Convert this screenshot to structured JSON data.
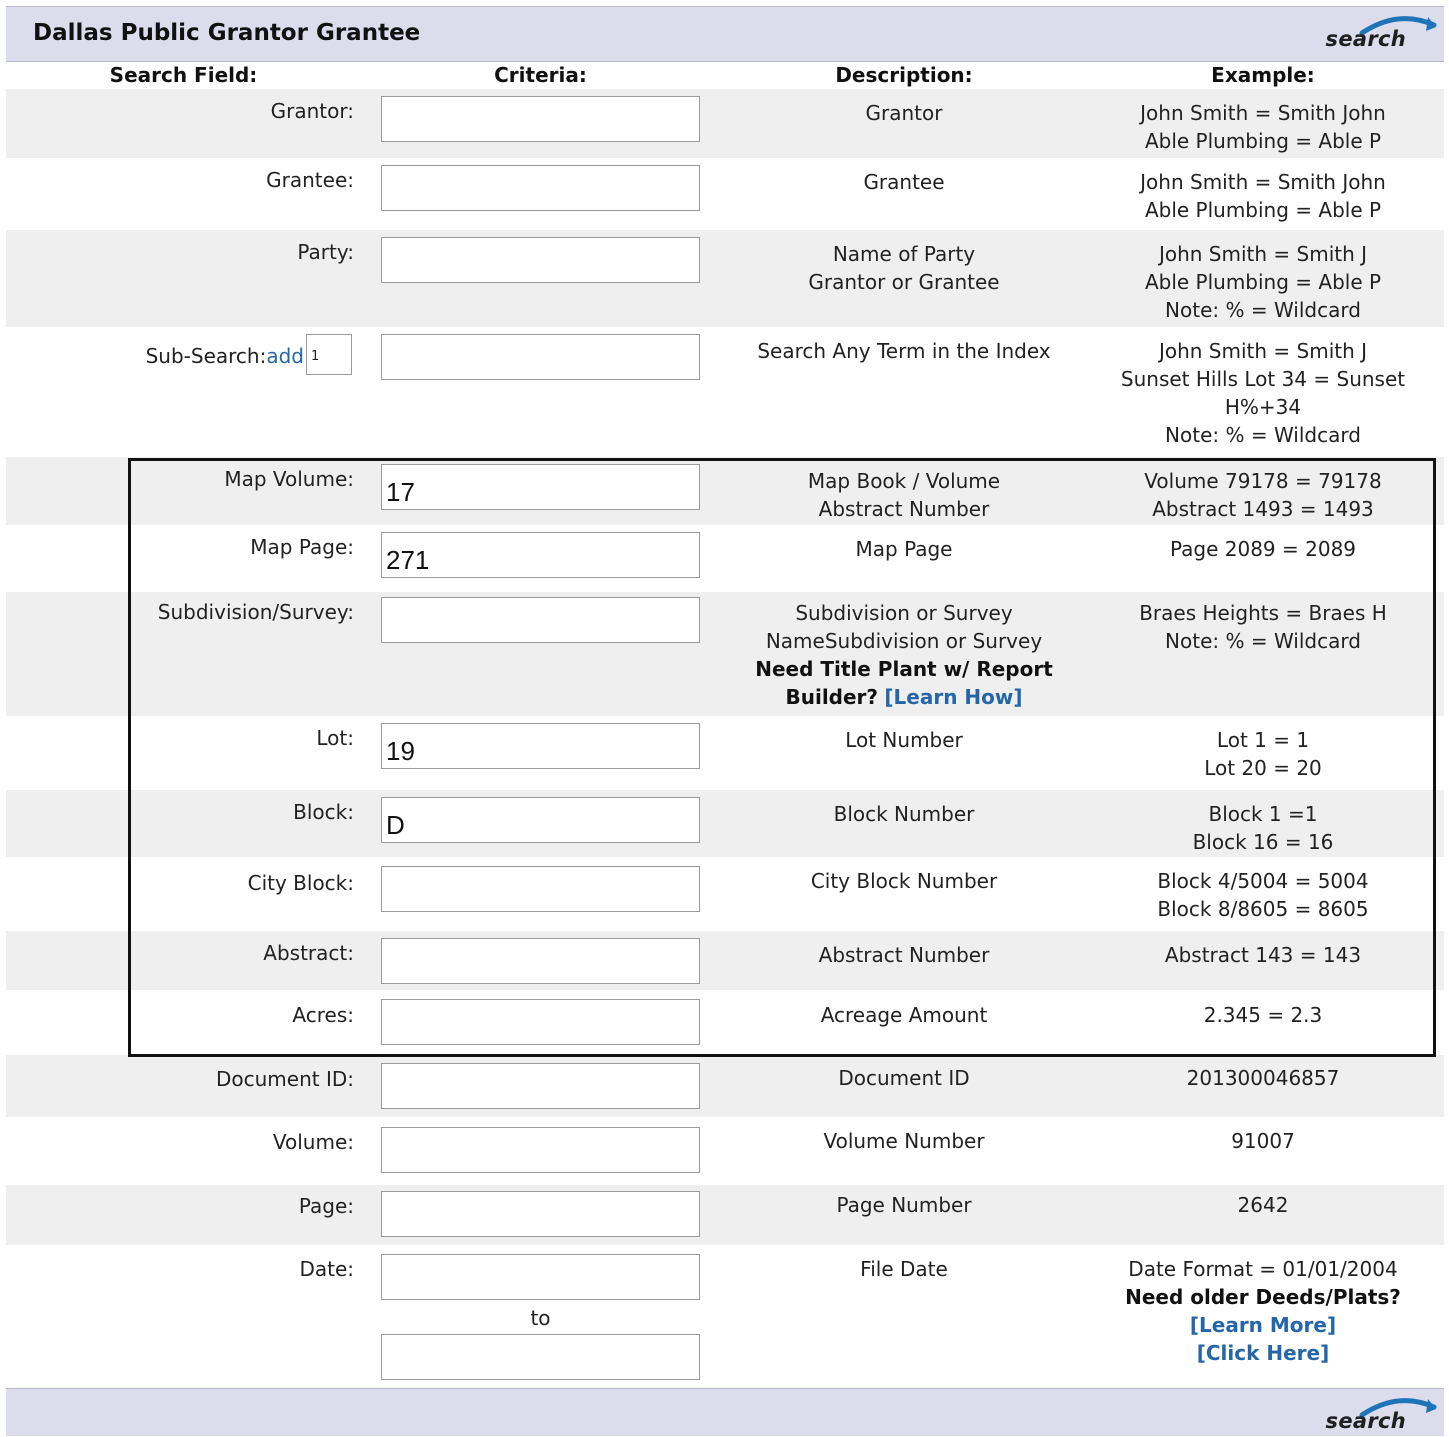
{
  "header": {
    "title": "Dallas Public Grantor Grantee",
    "search_label": "search"
  },
  "footer": {
    "search_label": "search"
  },
  "columns": {
    "field": "Search Field:",
    "criteria": "Criteria:",
    "description": "Description:",
    "example": "Example:"
  },
  "rows": {
    "grantor": {
      "label": "Grantor:",
      "value": "",
      "desc": [
        "Grantor"
      ],
      "example": [
        "John Smith = Smith John",
        "Able Plumbing = Able P"
      ]
    },
    "grantee": {
      "label": "Grantee:",
      "value": "",
      "desc": [
        "Grantee"
      ],
      "example": [
        "John Smith = Smith John",
        "Able Plumbing = Able P"
      ]
    },
    "party": {
      "label": "Party:",
      "value": "",
      "desc": [
        "Name of Party",
        "Grantor or Grantee"
      ],
      "example": [
        "John Smith = Smith J",
        "Able Plumbing = Able P",
        "Note: % = Wildcard"
      ]
    },
    "subsearch": {
      "label": "Sub-Search:",
      "add_link": "add",
      "count": "1",
      "value": "",
      "desc": [
        "Search Any Term in the Index"
      ],
      "example": [
        "John Smith = Smith J",
        "Sunset Hills Lot 34 = Sunset",
        "H%+34",
        "Note: % = Wildcard"
      ]
    },
    "map_volume": {
      "label": "Map Volume:",
      "value": "17",
      "desc": [
        "Map Book / Volume",
        "Abstract Number"
      ],
      "example": [
        "Volume 79178 = 79178",
        "Abstract 1493 = 1493"
      ]
    },
    "map_page": {
      "label": "Map Page:",
      "value": "271",
      "desc": [
        "Map Page"
      ],
      "example": [
        "Page 2089 = 2089"
      ]
    },
    "subdivision": {
      "label": "Subdivision/Survey:",
      "value": "",
      "desc": [
        "Subdivision or Survey",
        "NameSubdivision or Survey"
      ],
      "desc_bold": "Need Title Plant w/ Report",
      "desc_bold2": "Builder?",
      "desc_link": "[Learn How]",
      "example": [
        "Braes Heights = Braes H",
        "Note: % = Wildcard"
      ]
    },
    "lot": {
      "label": "Lot:",
      "value": "19",
      "desc": [
        "Lot Number"
      ],
      "example": [
        "Lot 1 = 1",
        "Lot 20 = 20"
      ]
    },
    "block": {
      "label": "Block:",
      "value": "D",
      "desc": [
        "Block Number"
      ],
      "example": [
        "Block 1 =1",
        "Block 16 = 16"
      ]
    },
    "city_block": {
      "label": "City Block:",
      "value": "",
      "desc": [
        "City Block Number"
      ],
      "example": [
        "Block 4/5004 = 5004",
        "Block 8/8605 = 8605"
      ]
    },
    "abstract": {
      "label": "Abstract:",
      "value": "",
      "desc": [
        "Abstract Number"
      ],
      "example": [
        "Abstract 143 = 143"
      ]
    },
    "acres": {
      "label": "Acres:",
      "value": "",
      "desc": [
        "Acreage Amount"
      ],
      "example": [
        "2.345 = 2.3"
      ]
    },
    "document_id": {
      "label": "Document ID:",
      "value": "",
      "desc": [
        "Document ID"
      ],
      "example": [
        "201300046857"
      ]
    },
    "volume": {
      "label": "Volume:",
      "value": "",
      "desc": [
        "Volume Number"
      ],
      "example": [
        "91007"
      ]
    },
    "page": {
      "label": "Page:",
      "value": "",
      "desc": [
        "Page Number"
      ],
      "example": [
        "2642"
      ]
    },
    "date": {
      "label": "Date:",
      "value_from": "",
      "to_text": "to",
      "value_to": "",
      "desc": [
        "File Date"
      ],
      "example": [
        "Date Format = 01/01/2004"
      ],
      "example_bold": "Need older Deeds/Plats?",
      "link_learn_more": "[Learn More]",
      "link_click_here": "[Click Here]"
    }
  },
  "colors": {
    "header_bg": "#dcdcec",
    "row_shade": "#efefef",
    "link": "#2466a8",
    "logo_arc": "#1f74b8"
  }
}
